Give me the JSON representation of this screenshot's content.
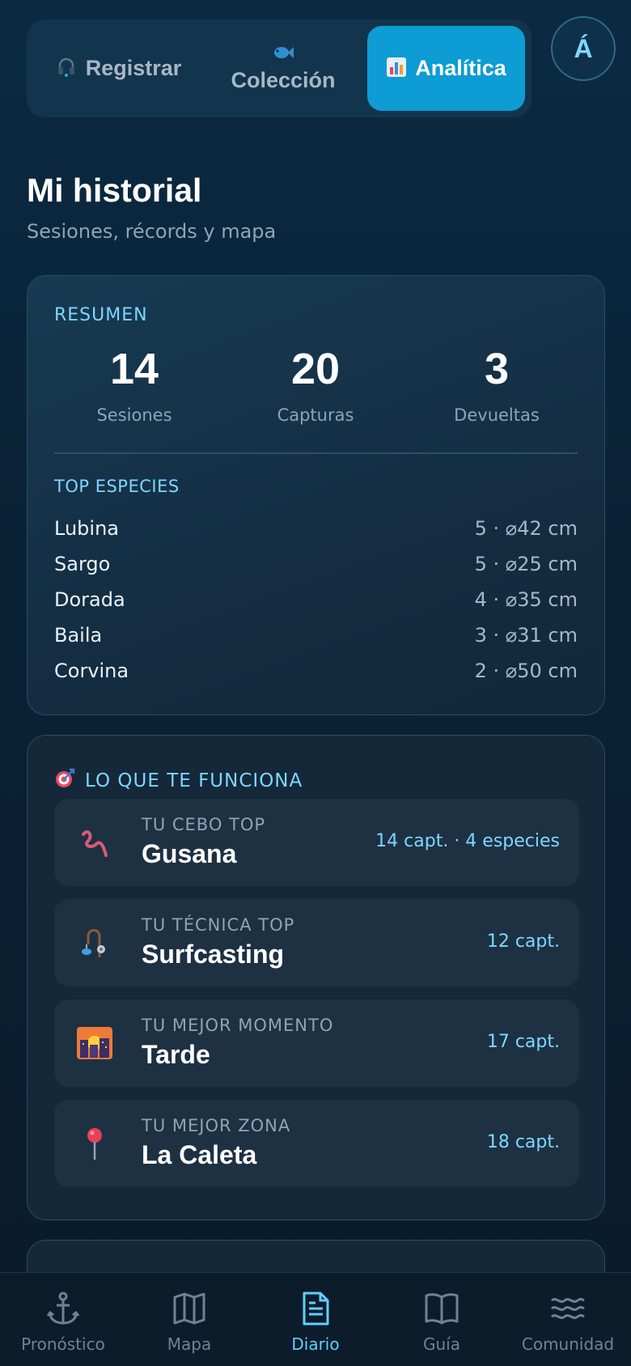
{
  "segment": {
    "tabs": [
      {
        "label": "Registrar",
        "icon": "headset-icon"
      },
      {
        "label": "Colección",
        "icon": "fish-icon"
      },
      {
        "label": "Analítica",
        "icon": "bar-chart-icon"
      }
    ],
    "active": 2
  },
  "avatar": {
    "initial": "Á"
  },
  "header": {
    "title": "Mi historial",
    "subtitle": "Sesiones, récords y mapa"
  },
  "summary": {
    "label": "RESUMEN",
    "stats": [
      {
        "value": "14",
        "label": "Sesiones"
      },
      {
        "value": "20",
        "label": "Capturas"
      },
      {
        "value": "3",
        "label": "Devueltas"
      }
    ],
    "top_label": "TOP ESPECIES",
    "species": [
      {
        "name": "Lubina",
        "value": "5 · ⌀42 cm"
      },
      {
        "name": "Sargo",
        "value": "5 · ⌀25 cm"
      },
      {
        "name": "Dorada",
        "value": "4 · ⌀35 cm"
      },
      {
        "name": "Baila",
        "value": "3 · ⌀31 cm"
      },
      {
        "name": "Corvina",
        "value": "2 · ⌀50 cm"
      }
    ]
  },
  "works": {
    "title": "LO QUE TE FUNCIONA",
    "title_icon": "target-icon",
    "items": [
      {
        "caption": "TU CEBO TOP",
        "value": "Gusana",
        "stat": "14 capt. · 4 especies",
        "icon": "worm-icon"
      },
      {
        "caption": "TU TÉCNICA TOP",
        "value": "Surfcasting",
        "stat": "12 capt.",
        "icon": "fishing-rod-icon"
      },
      {
        "caption": "TU MEJOR MOMENTO",
        "value": "Tarde",
        "stat": "17 capt.",
        "icon": "sunset-icon"
      },
      {
        "caption": "TU MEJOR ZONA",
        "value": "La Caleta",
        "stat": "18 capt.",
        "icon": "pin-icon"
      }
    ]
  },
  "nav": {
    "items": [
      {
        "label": "Pronóstico",
        "icon": "anchor-icon"
      },
      {
        "label": "Mapa",
        "icon": "map-icon"
      },
      {
        "label": "Diario",
        "icon": "document-icon"
      },
      {
        "label": "Guía",
        "icon": "book-icon"
      },
      {
        "label": "Comunidad",
        "icon": "waves-icon"
      }
    ],
    "active": 2
  },
  "colors": {
    "accent": "#0d9cd3",
    "accent_text": "#7fd6ff",
    "background": "#0a2236"
  }
}
